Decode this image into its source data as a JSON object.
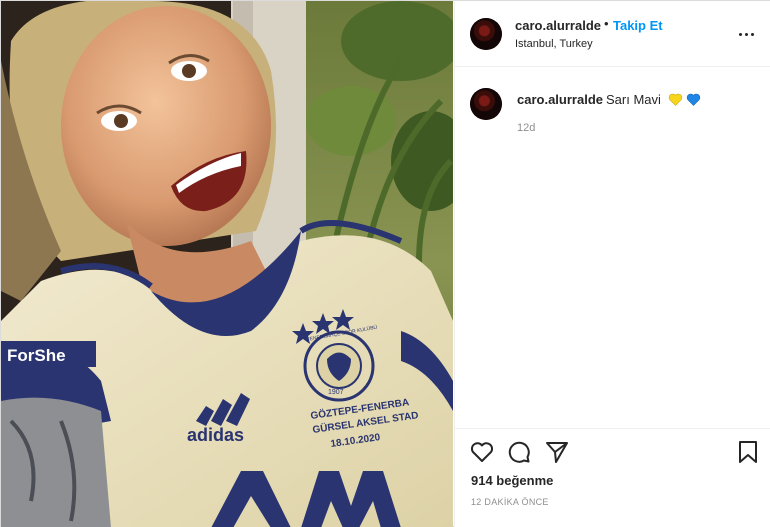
{
  "post": {
    "author": "caro.alurralde",
    "separator": "•",
    "follow_label": "Takip Et",
    "location": "Istanbul, Turkey",
    "more_icon": "more-horizontal-icon"
  },
  "caption": {
    "author": "caro.alurralde",
    "text": "Sarı Mavi",
    "emojis": [
      "yellow-heart-icon",
      "blue-heart-icon"
    ],
    "time": "12d"
  },
  "actions": {
    "icons": [
      "heart-icon",
      "comment-icon",
      "share-icon",
      "bookmark-icon"
    ],
    "likes": "914 beğenme",
    "posted_ago": "12 DAKİKA ÖNCE"
  },
  "photo": {
    "jersey_texts": {
      "sleeve": "ForShe",
      "brand": "adidas",
      "crest": "FENERBAHÇE SPOR KULÜBÜ",
      "crest_year": "1907",
      "match_line1": "GÖZTEPE-FENERBA",
      "match_line2": "GÜRSEL AKSEL STAD",
      "match_date": "18.10.2020"
    }
  },
  "colors": {
    "accent": "#0095f6",
    "jersey": "#ece3bd",
    "jersey_navy": "#2a3470",
    "yellow_heart": "#f7d51d",
    "blue_heart": "#1f86e6"
  }
}
